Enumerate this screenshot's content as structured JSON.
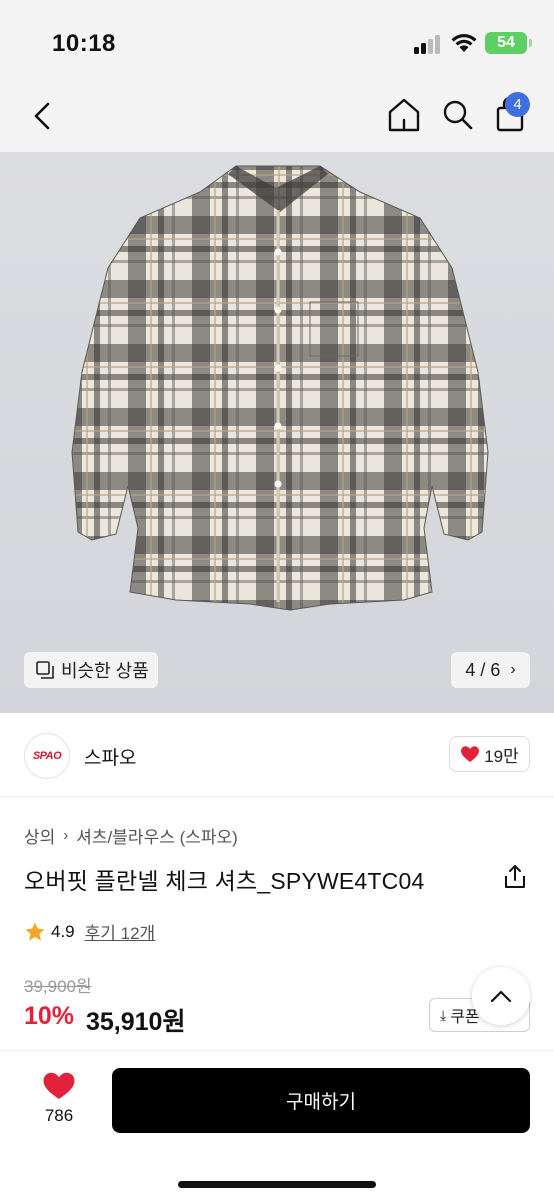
{
  "status_bar": {
    "time": "10:18",
    "battery": "54"
  },
  "nav": {
    "cart_count": "4"
  },
  "gallery": {
    "similar_label": "비슷한 상품",
    "page_indicator": "4 / 6",
    "icons": [
      "similar-icon",
      "chevron-right-icon"
    ]
  },
  "brand": {
    "logo_text": "SPAO",
    "name": "스파오",
    "likes": "19만"
  },
  "product": {
    "breadcrumb": [
      "상의",
      "셔츠/블라우스 (스파오)"
    ],
    "title": "오버핏 플란넬 체크 셔츠_SPYWE4TC04",
    "rating": "4.9",
    "reviews": "후기 12개",
    "original_price": "39,900원",
    "discount": "10%",
    "price": "35,910원",
    "coupon_label": "쿠폰"
  },
  "bottom": {
    "wish_count": "786",
    "buy_label": "구매하기"
  },
  "colors": {
    "accent_red": "#e4213a",
    "badge_blue": "#3e6fe0",
    "battery_green": "#5fcf65",
    "star": "#f5a623"
  }
}
